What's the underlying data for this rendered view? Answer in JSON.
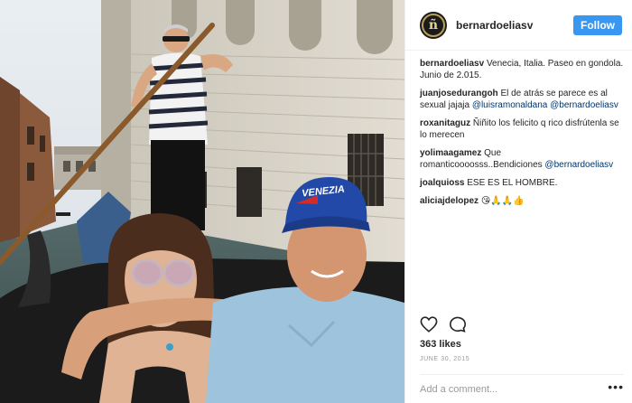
{
  "post": {
    "username": "bernardoeliasv",
    "avatar_initial": "ñ",
    "follow_label": "Follow",
    "photo": {
      "cap_text": "VENEZIA",
      "description": "Couple in a gondola in Venice with gondolier"
    },
    "comments": [
      {
        "user": "bernardoeliasv",
        "segments": [
          {
            "text": "Venecia, Italia. Paseo en gondola. Junio de 2.015.",
            "mention": false
          }
        ]
      },
      {
        "user": "juanjosedurangoh",
        "segments": [
          {
            "text": "El de atrás se parece es al sexual jajaja ",
            "mention": false
          },
          {
            "text": "@luisramonaldana",
            "mention": true
          },
          {
            "text": " ",
            "mention": false
          },
          {
            "text": "@bernardoeliasv",
            "mention": true
          }
        ]
      },
      {
        "user": "roxanitaguz",
        "segments": [
          {
            "text": "Ñiñito los felicito q rico disfrútenla se lo merecen",
            "mention": false
          }
        ]
      },
      {
        "user": "yolimaagamez",
        "segments": [
          {
            "text": "Que romanticoooosss..Bendiciones ",
            "mention": false
          },
          {
            "text": "@bernardoeliasv",
            "mention": true
          }
        ]
      },
      {
        "user": "joalquioss",
        "segments": [
          {
            "text": "ESE ES EL HOMBRE.",
            "mention": false
          }
        ]
      },
      {
        "user": "aliciajdelopez",
        "segments": [
          {
            "text": "😘🙏🙏👍",
            "mention": false
          }
        ]
      }
    ],
    "actions": {
      "like_icon": "heart-icon",
      "comment_icon": "comment-bubble-icon"
    },
    "likes_text": "363 likes",
    "date_text": "JUNE 30, 2015",
    "add_comment_placeholder": "Add a comment...",
    "more_label": "•••"
  }
}
